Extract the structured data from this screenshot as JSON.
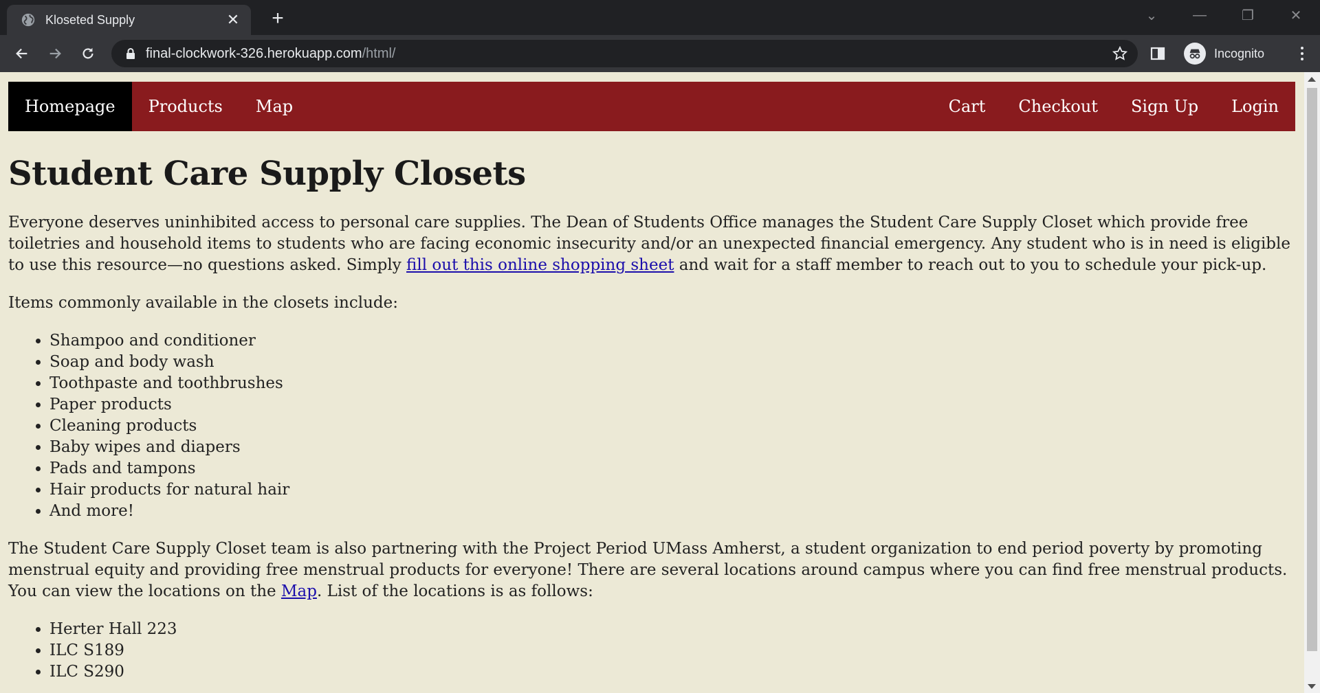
{
  "browser": {
    "tab_title": "Kloseted Supply",
    "url_host": "final-clockwork-326.herokuapp.com",
    "url_path": "/html/",
    "profile_label": "Incognito"
  },
  "nav": {
    "left": [
      "Homepage",
      "Products",
      "Map"
    ],
    "right": [
      "Cart",
      "Checkout",
      "Sign Up",
      "Login"
    ],
    "active": "Homepage"
  },
  "page": {
    "title": "Student Care Supply Closets",
    "intro_before_link": "Everyone deserves uninhibited access to personal care supplies. The Dean of Students Office manages the Student Care Supply Closet which provide free toiletries and household items to students who are facing economic insecurity and/or an unexpected financial emergency. Any student who is in need is eligible to use this resource—no questions asked. Simply ",
    "intro_link": "fill out this online shopping sheet",
    "intro_after_link": " and wait for a staff member to reach out to you to schedule your pick-up.",
    "items_heading": "Items commonly available in the closets include:",
    "items": [
      "Shampoo and conditioner",
      "Soap and body wash",
      "Toothpaste and toothbrushes",
      "Paper products",
      "Cleaning products",
      "Baby wipes and diapers",
      "Pads and tampons",
      "Hair products for natural hair",
      "And more!"
    ],
    "partner_before_link": "The Student Care Supply Closet team is also partnering with the Project Period UMass Amherst, a student organization to end period poverty by promoting menstrual equity and providing free menstrual products for everyone! There are several locations around campus where you can find free menstrual products. You can view the locations on the ",
    "partner_link": "Map",
    "partner_after_link": ". List of the locations is as follows:",
    "locations": [
      "Herter Hall 223",
      "ILC S189",
      "ILC S290"
    ]
  },
  "colors": {
    "nav_bg": "#891b1e",
    "nav_active_bg": "#000000",
    "page_bg": "#ece9d6",
    "link": "#1a0dab"
  }
}
